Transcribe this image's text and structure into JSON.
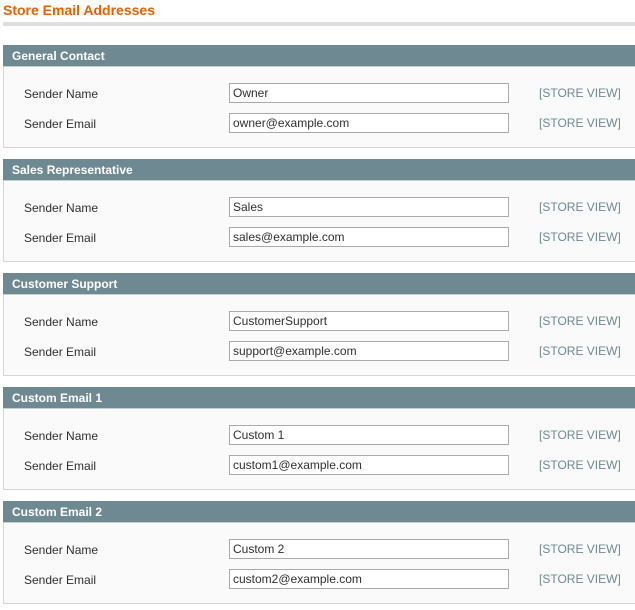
{
  "page": {
    "title": "Store Email Addresses"
  },
  "sections": [
    {
      "title": "General Contact",
      "fields": [
        {
          "label": "Sender Name",
          "value": "Owner",
          "scope": "[STORE VIEW]"
        },
        {
          "label": "Sender Email",
          "value": "owner@example.com",
          "scope": "[STORE VIEW]"
        }
      ]
    },
    {
      "title": "Sales Representative",
      "fields": [
        {
          "label": "Sender Name",
          "value": "Sales",
          "scope": "[STORE VIEW]"
        },
        {
          "label": "Sender Email",
          "value": "sales@example.com",
          "scope": "[STORE VIEW]"
        }
      ]
    },
    {
      "title": "Customer Support",
      "fields": [
        {
          "label": "Sender Name",
          "value": "CustomerSupport",
          "scope": "[STORE VIEW]"
        },
        {
          "label": "Sender Email",
          "value": "support@example.com",
          "scope": "[STORE VIEW]"
        }
      ]
    },
    {
      "title": "Custom Email 1",
      "fields": [
        {
          "label": "Sender Name",
          "value": "Custom 1",
          "scope": "[STORE VIEW]"
        },
        {
          "label": "Sender Email",
          "value": "custom1@example.com",
          "scope": "[STORE VIEW]"
        }
      ]
    },
    {
      "title": "Custom Email 2",
      "fields": [
        {
          "label": "Sender Name",
          "value": "Custom 2",
          "scope": "[STORE VIEW]"
        },
        {
          "label": "Sender Email",
          "value": "custom2@example.com",
          "scope": "[STORE VIEW]"
        }
      ]
    }
  ],
  "colors": {
    "title": "#eb5e00",
    "section_header": "#6f8992",
    "scope_text": "#6f8992"
  }
}
